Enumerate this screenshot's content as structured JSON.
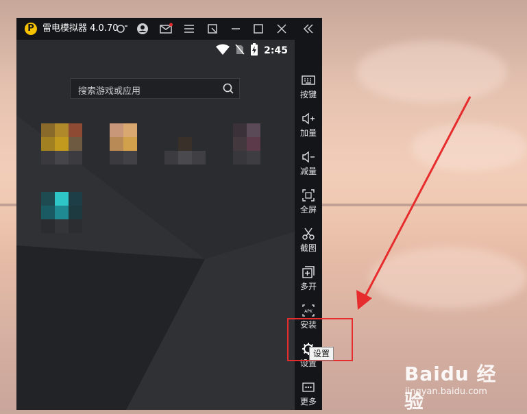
{
  "window": {
    "title": "雷电模拟器 4.0.70",
    "logo": "P",
    "icons": [
      "gamepad-icon",
      "user-icon",
      "mail-icon",
      "menu-icon",
      "restore-icon",
      "minimize-icon",
      "maximize-icon",
      "close-icon",
      "collapse-icon"
    ]
  },
  "status_bar": {
    "time": "2:45"
  },
  "search": {
    "placeholder": "搜索游戏或应用"
  },
  "sidebar": {
    "items": [
      {
        "label": "按键",
        "icon": "keyboard-icon"
      },
      {
        "label": "加量",
        "icon": "volume-up-icon"
      },
      {
        "label": "减量",
        "icon": "volume-down-icon"
      },
      {
        "label": "全屏",
        "icon": "fullscreen-icon"
      },
      {
        "label": "截图",
        "icon": "scissors-icon"
      },
      {
        "label": "多开",
        "icon": "multi-instance-icon"
      },
      {
        "label": "安装",
        "icon": "apk-install-icon"
      },
      {
        "label": "设置",
        "icon": "gear-icon"
      },
      {
        "label": "更多",
        "icon": "more-icon"
      }
    ]
  },
  "tooltip": {
    "text": "设置"
  },
  "annotation": {
    "highlight_color": "#e62c2c",
    "arrow_color": "#e62c2c"
  },
  "watermark": {
    "brand": "Baidu 经验",
    "url": "jingyan.baidu.com"
  }
}
